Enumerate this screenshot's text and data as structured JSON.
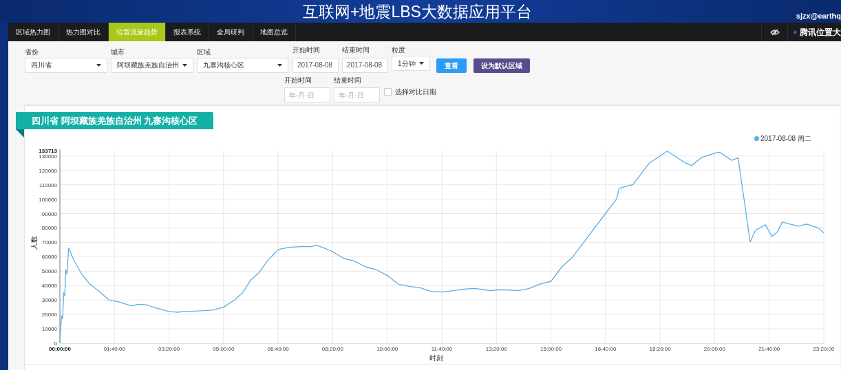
{
  "header": {
    "title": "互联网+地震LBS大数据应用平台",
    "user": "sjzx@earthq"
  },
  "nav": {
    "tabs": [
      {
        "label": "区域热力图",
        "selected": false
      },
      {
        "label": "热力图对比",
        "selected": false
      },
      {
        "label": "位置流量趋势",
        "selected": true
      },
      {
        "label": "报表系统",
        "selected": false
      },
      {
        "label": "全局研判",
        "selected": false
      },
      {
        "label": "地图总览",
        "selected": false
      }
    ],
    "brand": "腾讯位置大"
  },
  "filters": {
    "selects": [
      {
        "label": "省份",
        "value": "四川省"
      },
      {
        "label": "城市",
        "value": "阿坝藏族羌族自治州"
      },
      {
        "label": "区域",
        "value": "九寨沟核心区"
      }
    ],
    "start": {
      "label": "开始时间",
      "value": "2017-08-08"
    },
    "end": {
      "label": "结束时间",
      "value": "2017-08-08"
    },
    "granularity": {
      "label": "粒度",
      "value": "1分钟"
    },
    "buttons": [
      {
        "label": "查看",
        "kind": "primary"
      },
      {
        "label": "设为默认区域",
        "kind": "secondary"
      }
    ],
    "compare_start": {
      "label": "开始时间",
      "placeholder": "年-月-日"
    },
    "compare_end": {
      "label": "结束时间",
      "placeholder": "年-月-日"
    },
    "compare_checkbox": {
      "label": "选择对比日期",
      "checked": false
    }
  },
  "card": {
    "title": "四川省  阿坝藏族羌族自治州  九寨沟核心区",
    "chart_data": {
      "type": "line",
      "grid": true,
      "xlabel": "时刻",
      "ylabel": "人数",
      "xlim": [
        0,
        1400
      ],
      "ylim": [
        0,
        133713
      ],
      "xticks": [
        {
          "value": 0,
          "label": "00:00:00"
        },
        {
          "value": 100,
          "label": "01:40:00"
        },
        {
          "value": 200,
          "label": "03:20:00"
        },
        {
          "value": 300,
          "label": "05:00:00"
        },
        {
          "value": 400,
          "label": "06:40:00"
        },
        {
          "value": 500,
          "label": "08:20:00"
        },
        {
          "value": 600,
          "label": "10:00:00"
        },
        {
          "value": 700,
          "label": "11:40:00"
        },
        {
          "value": 800,
          "label": "13:20:00"
        },
        {
          "value": 900,
          "label": "15:00:00"
        },
        {
          "value": 1000,
          "label": "16:40:00"
        },
        {
          "value": 1100,
          "label": "18:20:00"
        },
        {
          "value": 1200,
          "label": "20:00:00"
        },
        {
          "value": 1300,
          "label": "21:40:00"
        },
        {
          "value": 1400,
          "label": "23:20:00"
        }
      ],
      "yticks": [
        0,
        10000,
        20000,
        30000,
        40000,
        50000,
        60000,
        70000,
        80000,
        90000,
        100000,
        110000,
        120000,
        130000,
        {
          "value": 133713,
          "label": "133713"
        }
      ],
      "x": [
        0,
        3,
        5,
        7,
        9,
        11,
        13,
        16,
        25,
        40,
        55,
        75,
        90,
        110,
        130,
        145,
        160,
        180,
        200,
        215,
        230,
        260,
        280,
        300,
        320,
        335,
        350,
        365,
        380,
        390,
        400,
        420,
        440,
        460,
        470,
        485,
        500,
        520,
        540,
        560,
        580,
        600,
        620,
        640,
        660,
        680,
        700,
        720,
        740,
        760,
        780,
        790,
        800,
        820,
        840,
        860,
        880,
        900,
        920,
        940,
        960,
        980,
        1000,
        1020,
        1025,
        1042,
        1050,
        1069,
        1080,
        1113,
        1147,
        1158,
        1176,
        1205,
        1210,
        1231,
        1243,
        1265,
        1275,
        1293,
        1305,
        1315,
        1324,
        1353,
        1369,
        1391,
        1400
      ],
      "series": [
        {
          "name": "2017-08-08 周二",
          "color": "#5aaee8",
          "values": [
            0,
            19000,
            17000,
            35000,
            33000,
            51000,
            48000,
            66000,
            58000,
            48000,
            41000,
            35000,
            30000,
            28500,
            26000,
            27000,
            26500,
            24000,
            22000,
            21500,
            22000,
            22500,
            23000,
            25000,
            30000,
            35000,
            44000,
            49000,
            57000,
            61000,
            65000,
            66500,
            67000,
            67000,
            68000,
            66000,
            63500,
            59000,
            57000,
            53000,
            51000,
            47000,
            41000,
            39500,
            38500,
            36000,
            35500,
            36500,
            37500,
            38000,
            37000,
            36500,
            37000,
            37000,
            36500,
            38000,
            41000,
            43000,
            53000,
            60000,
            70000,
            80000,
            90000,
            100000,
            107500,
            109400,
            110000,
            119500,
            125000,
            133400,
            125000,
            123300,
            129000,
            132400,
            132400,
            127000,
            128600,
            70300,
            78400,
            82200,
            74000,
            77400,
            84100,
            81300,
            82700,
            79800,
            76500
          ]
        }
      ]
    }
  }
}
